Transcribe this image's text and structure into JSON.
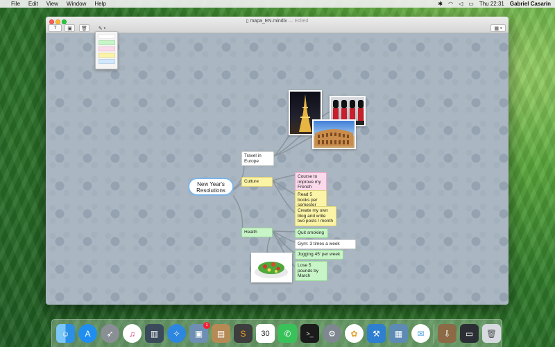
{
  "menubar": {
    "apple": "",
    "items": [
      "File",
      "Edit",
      "View",
      "Window",
      "Help"
    ],
    "clock": "Thu 22:31",
    "user": "Gabriel Casarin"
  },
  "window": {
    "filename": "mapa_EN.mindix",
    "status": "Edited",
    "toolbar": {
      "text_tool": "T",
      "picture_tool": "▣",
      "trash_tool": "🗑",
      "style_tool": "✎",
      "view_tool": "▦"
    }
  },
  "palette": {
    "colors": [
      "#ffffff",
      "#c8f5c7",
      "#fad9ea",
      "#fbf3a5",
      "#d0e8fb"
    ]
  },
  "map": {
    "central": "New Year's Resolutions",
    "branches": {
      "travel": "Travel in Europe",
      "culture": "Culture",
      "health": "Health"
    },
    "culture_items": {
      "french": "Course to improve my French",
      "books": "Read 5 books per semester",
      "blog": "Create my own blog and write two posts / month"
    },
    "health_items": {
      "smoking": "Quit smoking",
      "gym": "Gym: 3 times a week",
      "jogging": "Jogging 45' per week",
      "weight": "Lose 5 pounds by March"
    },
    "photos": {
      "paris": "eiffel-tower-photo",
      "london": "royal-guards-photo",
      "rome": "colosseum-photo",
      "salad": "salad-photo"
    }
  },
  "dock": {
    "calendar_day": "30",
    "badge_count": "1",
    "icons": [
      "finder-icon",
      "app-store-icon",
      "launchpad-icon",
      "itunes-icon",
      "mission-control-icon",
      "safari-icon",
      "preview-icon",
      "notes-icon",
      "sublime-icon",
      "calendar-icon",
      "facetime-icon",
      "terminal-icon",
      "system-preferences-icon",
      "photos-icon",
      "xcode-icon",
      "image-capture-icon",
      "messages-icon",
      "downloads-icon",
      "screen-icon",
      "trash-icon"
    ]
  }
}
